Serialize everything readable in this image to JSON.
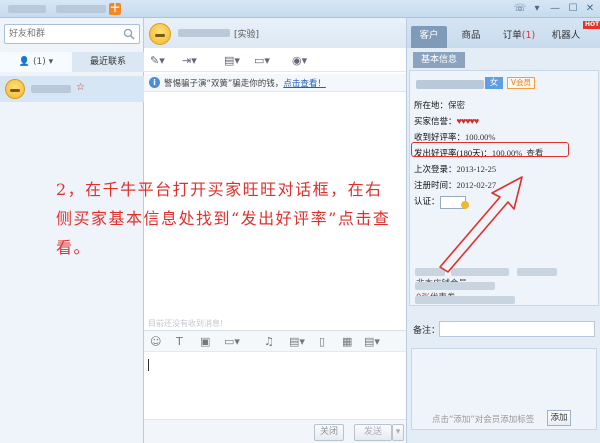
{
  "titlebar": {
    "badge": "十"
  },
  "left": {
    "search_placeholder": "好友和群",
    "tab_contacts": "(1)",
    "tab_recent": "最近联系"
  },
  "center": {
    "header_tag": "[实验]",
    "notice_text": "警惕骗子演“双簧”骗走你的钱，",
    "notice_link": "点击查看！",
    "annotation_text": "2，在千牛平台打开买家旺旺对话框，在右侧买家基本信息处找到“发出好评率”点击查看。",
    "history_hint": "目前还没有收到消息!",
    "close_label": "关闭",
    "send_label": "发送"
  },
  "right": {
    "tabs": [
      {
        "label": "客户",
        "active": true
      },
      {
        "label": "商品",
        "active": false
      },
      {
        "label": "订单",
        "count": "(1)",
        "active": false
      },
      {
        "label": "机器人",
        "active": false
      }
    ],
    "hot_badge": "HOT",
    "section_tab": "基本信息",
    "gender": "女",
    "vip": "会员",
    "location_label": "所在地：",
    "location_value": "保密",
    "credit_label": "买家信誉：",
    "received_rate_label": "收到好评率：",
    "received_rate_value": "100.00%",
    "sent_rate_label": "发出好评率(180天)：",
    "sent_rate_value": "100.00%",
    "view_label": "查看",
    "last_login_label": "上次登录：",
    "last_login_value": "2013-12-25",
    "register_label": "注册时间：",
    "register_value": "2012-02-27",
    "cert_label": "认证：",
    "member_text": "非本店铺会员",
    "coupon_prefix": "0张",
    "coupon_text": "优惠券",
    "remark_label": "备注：",
    "tag_hint": "点击“添加”对会员添加标签",
    "tag_add": "添加"
  }
}
